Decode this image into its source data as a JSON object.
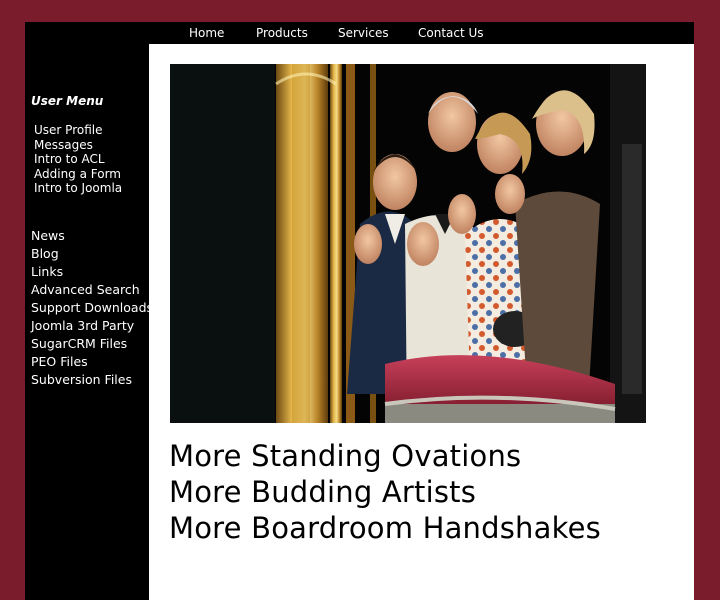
{
  "topnav": {
    "items": [
      {
        "label": "Home"
      },
      {
        "label": "Products"
      },
      {
        "label": "Services"
      },
      {
        "label": "Contact Us"
      }
    ]
  },
  "sidebar": {
    "user_menu_title": "User Menu",
    "user_menu": [
      {
        "label": "User Profile"
      },
      {
        "label": "Messages"
      },
      {
        "label": "Intro to ACL"
      },
      {
        "label": "Adding a Form"
      },
      {
        "label": "Intro to Joomla"
      }
    ],
    "main_menu": [
      {
        "label": "News"
      },
      {
        "label": "Blog"
      },
      {
        "label": "Links"
      },
      {
        "label": "Advanced Search"
      },
      {
        "label": "Support Downloads"
      },
      {
        "label": "Joomla 3rd Party"
      },
      {
        "label": "SugarCRM Files"
      },
      {
        "label": "PEO Files"
      },
      {
        "label": "Subversion Files"
      }
    ]
  },
  "main": {
    "taglines": [
      "More Standing Ovations",
      "More Budding Artists",
      "More Boardroom Handshakes"
    ]
  },
  "colors": {
    "page_background": "#7a1c2c",
    "sidebar_background": "#000000",
    "content_background": "#ffffff"
  }
}
